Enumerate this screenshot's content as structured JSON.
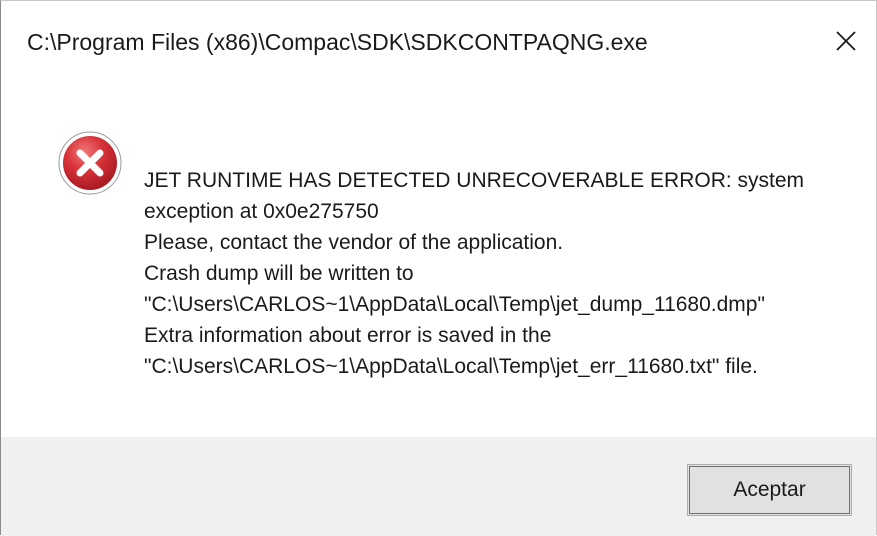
{
  "window": {
    "title": "C:\\Program Files (x86)\\Compac\\SDK\\SDKCONTPAQNG.exe",
    "close_icon": "close-icon"
  },
  "icon": {
    "name": "error-icon",
    "color": "#c6262e"
  },
  "message": {
    "lines": [
      "JET RUNTIME HAS DETECTED UNRECOVERABLE ERROR: system",
      "exception at 0x0e275750",
      "Please, contact the vendor of the application.",
      "Crash dump will be written to",
      "\"C:\\Users\\CARLOS~1\\AppData\\Local\\Temp\\jet_dump_11680.dmp\"",
      "Extra information about error is saved in the",
      "\"C:\\Users\\CARLOS~1\\AppData\\Local\\Temp\\jet_err_11680.txt\" file."
    ]
  },
  "buttons": {
    "ok_label": "Aceptar"
  }
}
